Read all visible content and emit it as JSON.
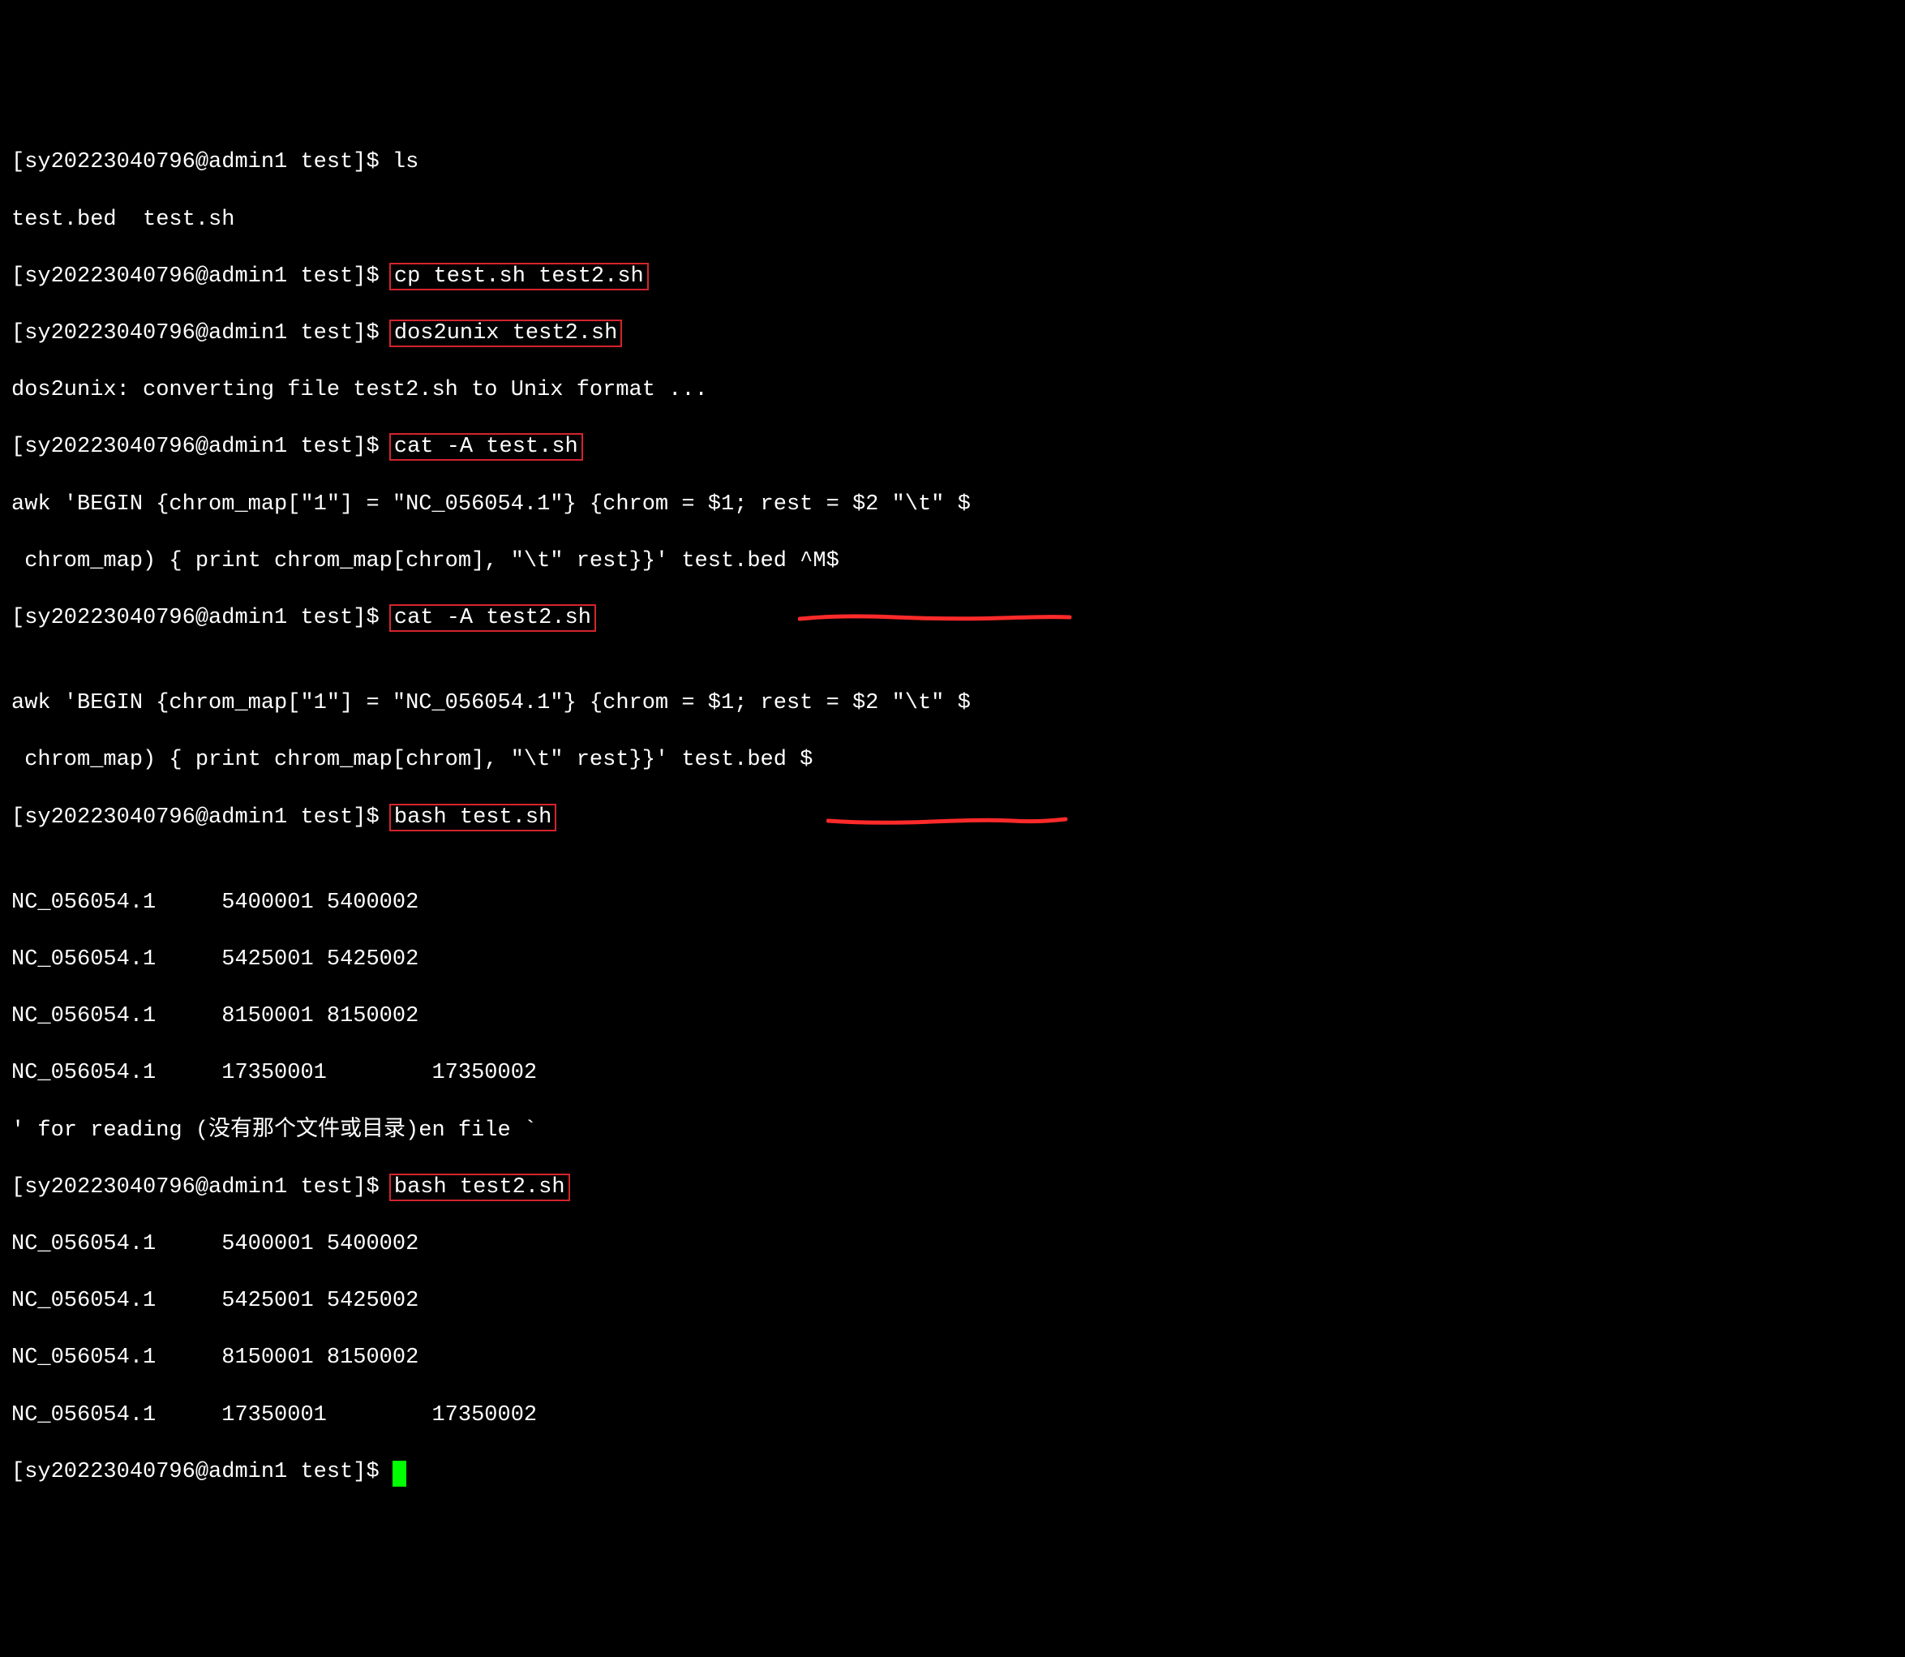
{
  "prompt": "[sy20223040796@admin1 test]$ ",
  "lines": {
    "l01_cmd": "ls",
    "l02_out": "test.bed  test.sh",
    "l03_cmd_boxed": "cp test.sh test2.sh",
    "l04_cmd_boxed": "dos2unix test2.sh",
    "l05_out": "dos2unix: converting file test2.sh to Unix format ...",
    "l06_cmd_boxed": "cat -A test.sh",
    "l07_out": "awk 'BEGIN {chrom_map[\"1\"] = \"NC_056054.1\"} {chrom = $1; rest = $2 \"\\t\" $",
    "l08_out": " chrom_map) { print chrom_map[chrom], \"\\t\" rest}}' test.bed ^M$",
    "l09_cmd_boxed": "cat -A test2.sh",
    "l10_out": "awk 'BEGIN {chrom_map[\"1\"] = \"NC_056054.1\"} {chrom = $1; rest = $2 \"\\t\" $",
    "l11_out": " chrom_map) { print chrom_map[chrom], \"\\t\" rest}}' test.bed $",
    "l12_cmd_boxed": "bash test.sh",
    "l13_out": "NC_056054.1     5400001 5400002",
    "l14_out": "NC_056054.1     5425001 5425002",
    "l15_out": "NC_056054.1     8150001 8150002",
    "l16_out": "NC_056054.1     17350001        17350002",
    "l17_out": "' for reading (没有那个文件或目录)en file `",
    "l18_cmd_boxed": "bash test2.sh",
    "l19_out": "NC_056054.1     5400001 5400002",
    "l20_out": "NC_056054.1     5425001 5425002",
    "l21_out": "NC_056054.1     8150001 8150002",
    "l22_out": "NC_056054.1     17350001        17350002"
  },
  "annotations": {
    "box_color": "#d4242c",
    "underline_color": "#ff2a2a"
  }
}
